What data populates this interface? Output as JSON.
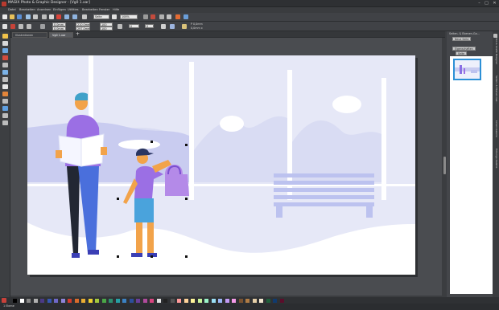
{
  "window": {
    "title": "MAGIX Photo & Graphic Designer - [Vg0 1.xar]",
    "min": "–",
    "max": "□",
    "close": "✕"
  },
  "menu": [
    "Datei",
    "Bearbeiten",
    "Anordnen",
    "Einfügen",
    "Utilities",
    "Bearbeiten",
    "Fenster",
    "Hilfe"
  ],
  "toolbar": {
    "zoom_mode": "Seite",
    "zoom_percent": "108%"
  },
  "infobar": {
    "x": "0,0mm",
    "y": "0,0mm",
    "w": "210,0mm",
    "h": "297,0mm",
    "rot": "0",
    "flip_h": "0",
    "pos_label": "P 0,0mm",
    "size_label": "0,0mm x",
    "x2": "0,0mm",
    "y2": "0,0mm",
    "scale": "100",
    "scale2": "100"
  },
  "tabs": [
    {
      "label": "Illustrationen"
    },
    {
      "label": "Vg0 1.xar"
    }
  ],
  "right_panel": {
    "title": "Seiten- & Ebenen-Ga...",
    "btn_new_page": "Neue Seite",
    "btn_properties": "Eigenschaften",
    "btn_side": "Seite",
    "thumb_label": "Ebene 1"
  },
  "right_strip": [
    "Foto & Grafik Designer",
    "Seiten- & Ebenen-Gal...",
    "Linien-Galerie",
    "Füllungs-Galerie"
  ],
  "status": {
    "left": "1 Ebene",
    "right": ""
  },
  "colors": {
    "accent": "#2c90d6",
    "bg": "#3b3d40",
    "canvas": "#4a4c50"
  },
  "palette": [
    "#000000",
    "#ffffff",
    "#888888",
    "#b0b0b0",
    "#4b3a86",
    "#3557b3",
    "#6f68c9",
    "#8e84d8",
    "#d33a2e",
    "#d96b2b",
    "#e9ad33",
    "#f0d12e",
    "#a3c93d",
    "#4aa747",
    "#2d8f6f",
    "#26a0a5",
    "#3b82c4",
    "#2c4f9c",
    "#6a3e9a",
    "#b04a9c",
    "#d9447f",
    "#e0e0e0",
    "#222222",
    "#555555",
    "#ff9a9a",
    "#ffd39a",
    "#fff59a",
    "#c9f59a",
    "#9af5c9",
    "#9adff5",
    "#9ab6f5",
    "#c39af5",
    "#f59ae8",
    "#7a5230",
    "#b07c45",
    "#e6cfa8",
    "#f2e6d0",
    "#1f5e3a",
    "#103a6e",
    "#5a0e2b"
  ]
}
